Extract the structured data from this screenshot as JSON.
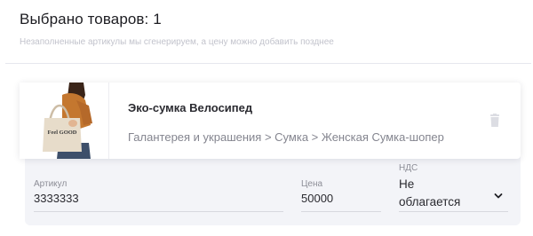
{
  "header": {
    "title": "Выбрано товаров: 1",
    "subtitle": "Незаполненные артикулы мы сгенерируем, а цену можно добавить позднее"
  },
  "product": {
    "name": "Эко-сумка Велосипед",
    "category": "Галантерея и украшения > Сумка > Женская Сумка-шопер",
    "bag_print": "Feel GOOD"
  },
  "fields": {
    "article": {
      "label": "Артикул",
      "value": "3333333"
    },
    "price": {
      "label": "Цена",
      "value": "50000"
    },
    "vat": {
      "label": "НДС",
      "value": "Не облагается"
    }
  },
  "icons": {
    "delete": "trash-icon",
    "dropdown": "chevron-down-icon"
  },
  "colors": {
    "panel_bg": "#f3f4f8",
    "muted_text": "#84858f",
    "title_text": "#1d1d22"
  }
}
